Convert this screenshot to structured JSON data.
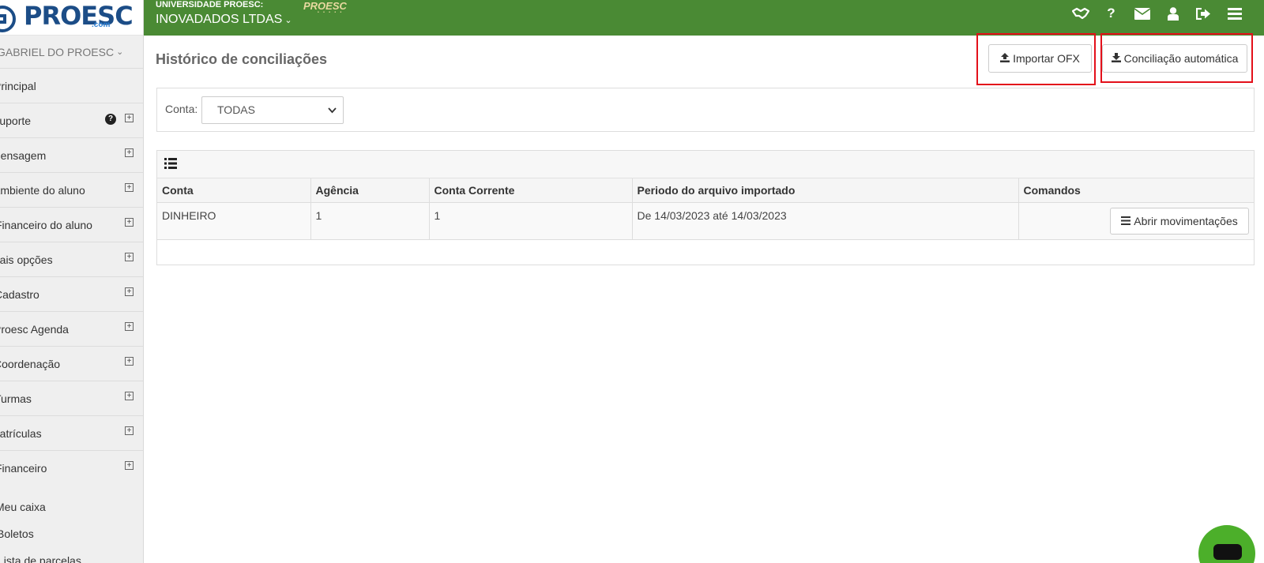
{
  "brand": {
    "logo_pro": "PRO",
    "logo_esc": "ESC",
    "logo_com": ".com"
  },
  "sidebar": {
    "user": "GABRIEL DO PROESC",
    "items": [
      {
        "label": "Principal"
      },
      {
        "label": "Suporte"
      },
      {
        "label": "Mensagem"
      },
      {
        "label": "Ambiente do aluno"
      },
      {
        "label": "Financeiro do aluno"
      },
      {
        "label": "Mais opções"
      },
      {
        "label": "Cadastro"
      },
      {
        "label": "Proesc Agenda"
      },
      {
        "label": "Coordenação"
      },
      {
        "label": "Turmas"
      },
      {
        "label": "Matrículas"
      },
      {
        "label": "Financeiro"
      }
    ],
    "subitems": [
      {
        "label": "Meu caixa"
      },
      {
        "label": "Boletos"
      },
      {
        "label": "Lista de parcelas"
      }
    ]
  },
  "topbar": {
    "org_small": "UNIVERSIDADE PROESC:",
    "org_name": "INOVADADOS LTDAS",
    "mini_logo": "PROESC",
    "icons": [
      "handshake-icon",
      "help-icon",
      "envelope-icon",
      "user-icon",
      "sign-out-icon",
      "menu-icon"
    ]
  },
  "main": {
    "title": "Histórico de conciliações",
    "import_label": "Importar OFX",
    "auto_label": "Conciliação automática",
    "filter_label": "Conta:",
    "filter_value": "TODAS",
    "table": {
      "headers": [
        "Conta",
        "Agência",
        "Conta Corrente",
        "Periodo do arquivo importado",
        "Comandos"
      ],
      "rows": [
        {
          "conta": "DINHEIRO",
          "agencia": "1",
          "conta_corrente": "1",
          "periodo": "De 14/03/2023 até 14/03/2023",
          "action": "Abrir movimentações"
        }
      ]
    }
  },
  "colors": {
    "topbar": "#4a8a34",
    "brand_blue": "#1c4d87",
    "highlight": "#e3101a",
    "chat": "#4caf2a"
  }
}
